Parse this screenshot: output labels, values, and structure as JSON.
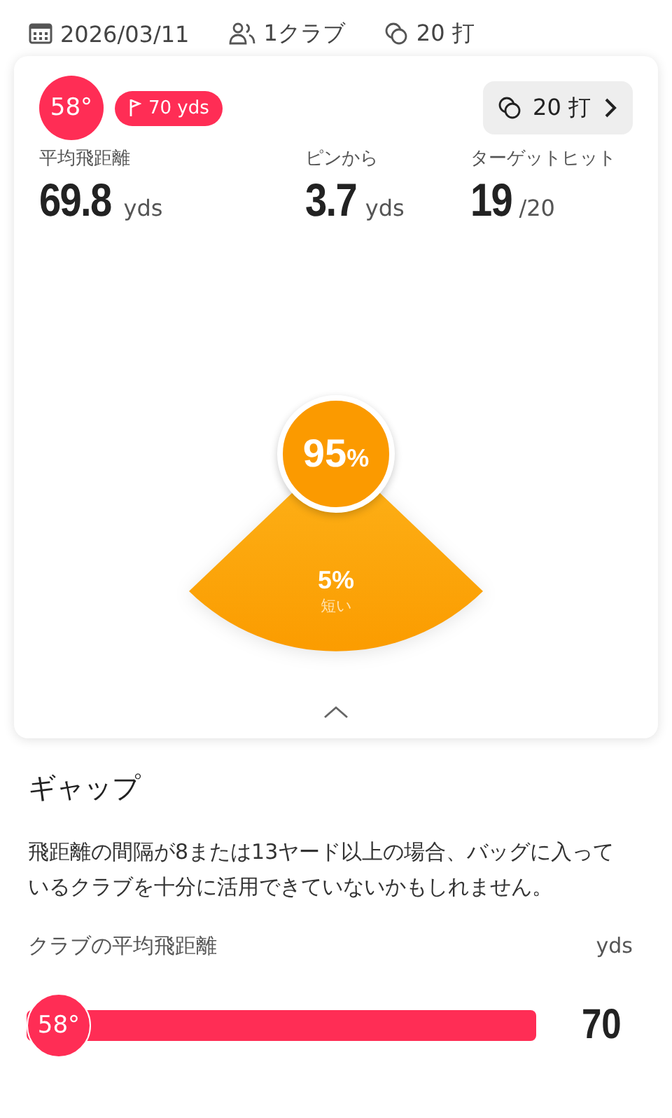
{
  "header": {
    "date": "2026/03/11",
    "clubs": "1クラブ",
    "shots": "20 打"
  },
  "card": {
    "loft": "58°",
    "target": "70 yds",
    "shots_button": "20 打",
    "stats": [
      {
        "label": "平均飛距離",
        "value": "69.8",
        "unit": "yds"
      },
      {
        "label": "ピンから",
        "value": "3.7",
        "unit": "yds"
      },
      {
        "label": "ターゲットヒット",
        "value": "19",
        "unit": "/20"
      }
    ],
    "gauge": {
      "main": "95",
      "main_unit": "%",
      "sector_value": "5%",
      "sector_label": "短い"
    },
    "expanded": true
  },
  "gap": {
    "title": "ギャップ",
    "description": "飛距離の間隔が8または13ヤード以上の場合、バッグに入っているクラブを十分に活用できていないかもしれません。",
    "chart_label": "クラブの平均飛距離",
    "unit": "yds",
    "bars": [
      {
        "club": "58°",
        "value": "70"
      }
    ]
  }
}
